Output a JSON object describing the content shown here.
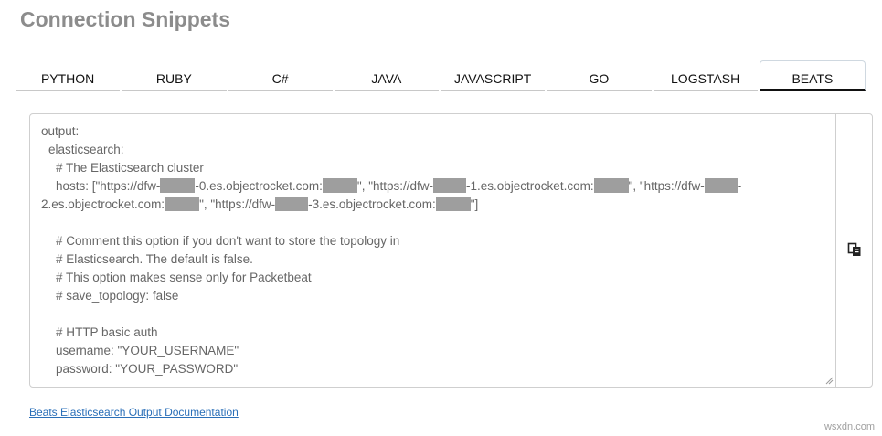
{
  "page": {
    "title": "Connection Snippets"
  },
  "tabs": [
    {
      "label": "PYTHON"
    },
    {
      "label": "RUBY"
    },
    {
      "label": "C#"
    },
    {
      "label": "JAVA"
    },
    {
      "label": "JAVASCRIPT"
    },
    {
      "label": "GO"
    },
    {
      "label": "LOGSTASH"
    },
    {
      "label": "BEATS",
      "active": true
    }
  ],
  "code": {
    "line1": "output:",
    "line2": "  elasticsearch:",
    "line3": "    # The Elasticsearch cluster",
    "line4_a": "    hosts: [\"https://dfw-",
    "line4_b": "-0.es.objectrocket.com:",
    "line4_c": "\", \"https://dfw-",
    "line4_d": "-1.es.objectrocket.com:",
    "line4_e": "\", \"https://dfw-",
    "line4_f": "-",
    "line5_a": "2.es.objectrocket.com:",
    "line5_b": "\", \"https://dfw-",
    "line5_c": "-3.es.objectrocket.com:",
    "line5_d": "\"]",
    "line6": "",
    "line7": "    # Comment this option if you don't want to store the topology in",
    "line8": "    # Elasticsearch. The default is false.",
    "line9": "    # This option makes sense only for Packetbeat",
    "line10": "    # save_topology: false",
    "line11": "",
    "line12": "    # HTTP basic auth",
    "line13": "    username: \"YOUR_USERNAME\"",
    "line14": "    password: \"YOUR_PASSWORD\""
  },
  "link": {
    "label": "Beats Elasticsearch Output Documentation"
  },
  "watermark": "wsxdn.com",
  "icons": {
    "copy": "copy-icon",
    "resize": "resize-handle-icon"
  },
  "colors": {
    "title": "#8c8c8c",
    "link": "#2a6fb8",
    "redaction": "#9e9e9e"
  }
}
